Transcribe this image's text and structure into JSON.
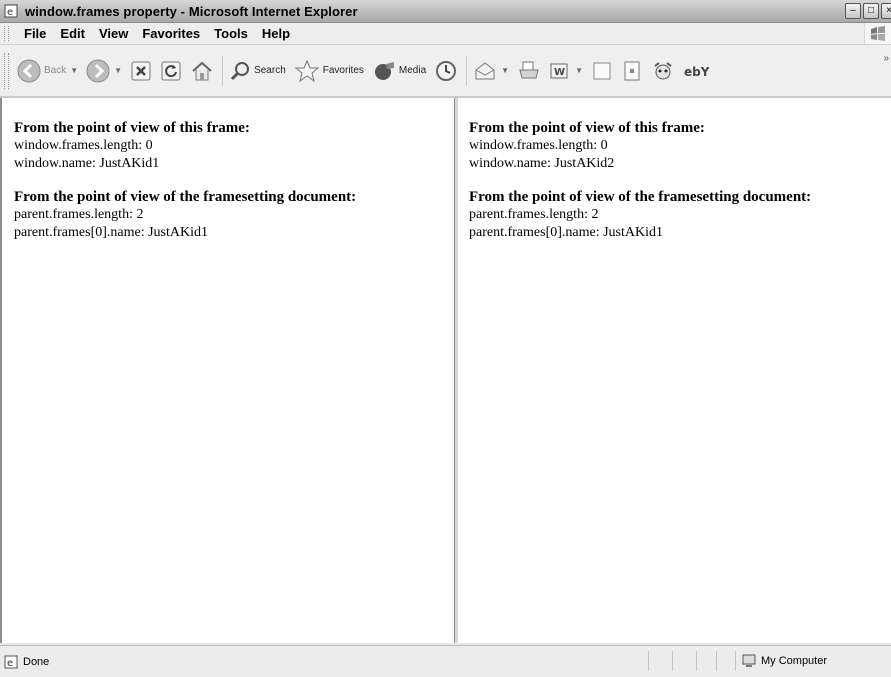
{
  "window": {
    "title": "window.frames property - Microsoft Internet Explorer"
  },
  "menu": {
    "items": [
      "File",
      "Edit",
      "View",
      "Favorites",
      "Tools",
      "Help"
    ]
  },
  "toolbar": {
    "back": "Back",
    "search": "Search",
    "favorites": "Favorites",
    "media": "Media"
  },
  "frames": [
    {
      "heading1": "From the point of view of this frame:",
      "frames_length": "window.frames.length: 0",
      "window_name": "window.name: JustAKid1",
      "heading2": "From the point of view of the framesetting document:",
      "parent_length": "parent.frames.length: 2",
      "parent_name": "parent.frames[0].name: JustAKid1"
    },
    {
      "heading1": "From the point of view of this frame:",
      "frames_length": "window.frames.length: 0",
      "window_name": "window.name: JustAKid2",
      "heading2": "From the point of view of the framesetting document:",
      "parent_length": "parent.frames.length: 2",
      "parent_name": "parent.frames[0].name: JustAKid1"
    }
  ],
  "status": {
    "left": "Done",
    "zone": "My Computer"
  }
}
